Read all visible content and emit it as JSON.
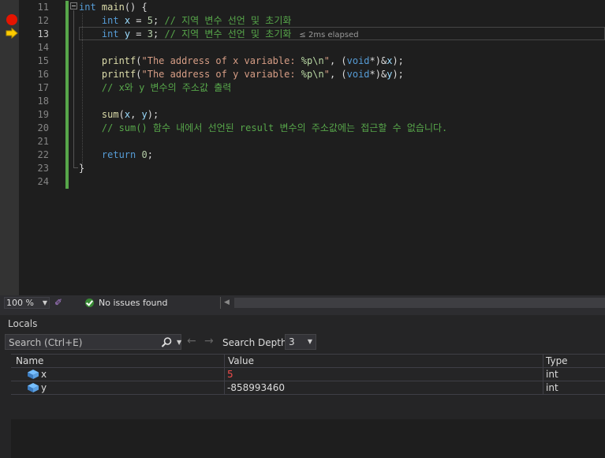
{
  "editor": {
    "lines": [
      {
        "num": "11",
        "tokens": [
          [
            "kw",
            "int"
          ],
          [
            "pl",
            " "
          ],
          [
            "fn",
            "main"
          ],
          [
            "pl",
            "() {"
          ]
        ]
      },
      {
        "num": "12",
        "tokens": [
          [
            "pl",
            "    "
          ],
          [
            "kw",
            "int"
          ],
          [
            "pl",
            " "
          ],
          [
            "var",
            "x"
          ],
          [
            "pl",
            " = "
          ],
          [
            "num",
            "5"
          ],
          [
            "pl",
            "; "
          ],
          [
            "com",
            "// 지역 변수 선언 및 초기화"
          ]
        ]
      },
      {
        "num": "13",
        "tokens": [
          [
            "pl",
            "    "
          ],
          [
            "kw",
            "int"
          ],
          [
            "pl",
            " "
          ],
          [
            "var",
            "y"
          ],
          [
            "pl",
            " = "
          ],
          [
            "num",
            "3"
          ],
          [
            "pl",
            "; "
          ],
          [
            "com",
            "// 지역 변수 선언 및 초기화"
          ]
        ]
      },
      {
        "num": "14",
        "tokens": []
      },
      {
        "num": "15",
        "tokens": [
          [
            "pl",
            "    "
          ],
          [
            "fn",
            "printf"
          ],
          [
            "pl",
            "("
          ],
          [
            "str",
            "\"The address of x variable: "
          ],
          [
            "fmt",
            "%p\\n"
          ],
          [
            "str",
            "\""
          ],
          [
            "pl",
            ", ("
          ],
          [
            "kw",
            "void"
          ],
          [
            "pl",
            "*)&"
          ],
          [
            "var",
            "x"
          ],
          [
            "pl",
            ");"
          ]
        ]
      },
      {
        "num": "16",
        "tokens": [
          [
            "pl",
            "    "
          ],
          [
            "fn",
            "printf"
          ],
          [
            "pl",
            "("
          ],
          [
            "str",
            "\"The address of y variable: "
          ],
          [
            "fmt",
            "%p\\n"
          ],
          [
            "str",
            "\""
          ],
          [
            "pl",
            ", ("
          ],
          [
            "kw",
            "void"
          ],
          [
            "pl",
            "*)&"
          ],
          [
            "var",
            "y"
          ],
          [
            "pl",
            ");"
          ]
        ]
      },
      {
        "num": "17",
        "tokens": [
          [
            "pl",
            "    "
          ],
          [
            "com",
            "// x와 y 변수의 주소값 출력"
          ]
        ]
      },
      {
        "num": "18",
        "tokens": []
      },
      {
        "num": "19",
        "tokens": [
          [
            "pl",
            "    "
          ],
          [
            "fn",
            "sum"
          ],
          [
            "pl",
            "("
          ],
          [
            "var",
            "x"
          ],
          [
            "pl",
            ", "
          ],
          [
            "var",
            "y"
          ],
          [
            "pl",
            ");"
          ]
        ]
      },
      {
        "num": "20",
        "tokens": [
          [
            "pl",
            "    "
          ],
          [
            "com",
            "// sum() 함수 내에서 선언된 result 변수의 주소값에는 접근할 수 없습니다."
          ]
        ]
      },
      {
        "num": "21",
        "tokens": []
      },
      {
        "num": "22",
        "tokens": [
          [
            "pl",
            "    "
          ],
          [
            "kw",
            "return"
          ],
          [
            "pl",
            " "
          ],
          [
            "num",
            "0"
          ],
          [
            "pl",
            ";"
          ]
        ]
      },
      {
        "num": "23",
        "tokens": [
          [
            "pl",
            "}"
          ]
        ]
      },
      {
        "num": "24",
        "tokens": []
      }
    ],
    "current_line": "13",
    "breakpoint_line": "12",
    "elapsed_hint": "≤ 2ms elapsed"
  },
  "status": {
    "zoom": "100 %",
    "issues": "No issues found"
  },
  "locals": {
    "title": "Locals",
    "search_placeholder": "Search (Ctrl+E)",
    "depth_label": "Search Depth:",
    "depth_value": "3",
    "columns": [
      "Name",
      "Value",
      "Type"
    ],
    "rows": [
      {
        "name": "x",
        "value": "5",
        "type": "int",
        "changed": true
      },
      {
        "name": "y",
        "value": "-858993460",
        "type": "int",
        "changed": false
      }
    ]
  },
  "colors": {
    "keyword": "#569cd6",
    "function": "#dcdcaa",
    "variable": "#9cdcfe",
    "string": "#d69d85",
    "comment": "#57a64a",
    "number": "#b5cea8",
    "changed_value": "#f14c4c",
    "breakpoint": "#e51400"
  }
}
